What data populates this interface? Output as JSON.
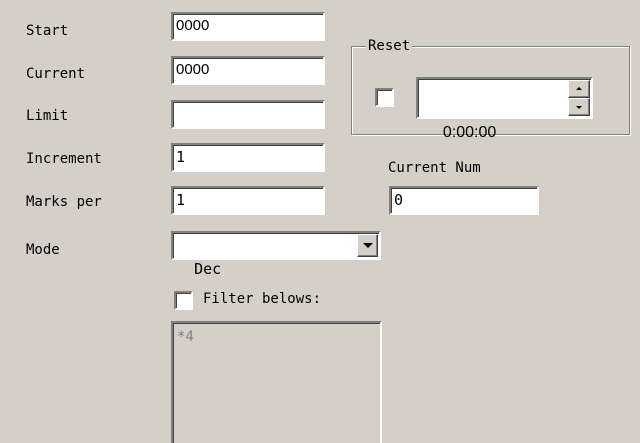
{
  "labels": {
    "start": "Start",
    "current": "Current",
    "limit": "Limit",
    "increment": "Increment",
    "marks_per": "Marks per",
    "mode": "Mode"
  },
  "fields": {
    "start_value": "0000",
    "current_value": "0000",
    "limit_value": "",
    "increment_value": "1",
    "marks_per_value": "1"
  },
  "mode_select": {
    "selected": "Dec"
  },
  "reset_group": {
    "title": "Reset",
    "checked": false,
    "time_value": "0:00:00"
  },
  "current_num": {
    "label": "Current Num",
    "value": "0"
  },
  "filter": {
    "label": "Filter belows:",
    "checked": false,
    "text": "*4"
  },
  "colors": {
    "background": "#d4d0c8",
    "field": "#ffffff",
    "disabled_text": "#808080"
  }
}
